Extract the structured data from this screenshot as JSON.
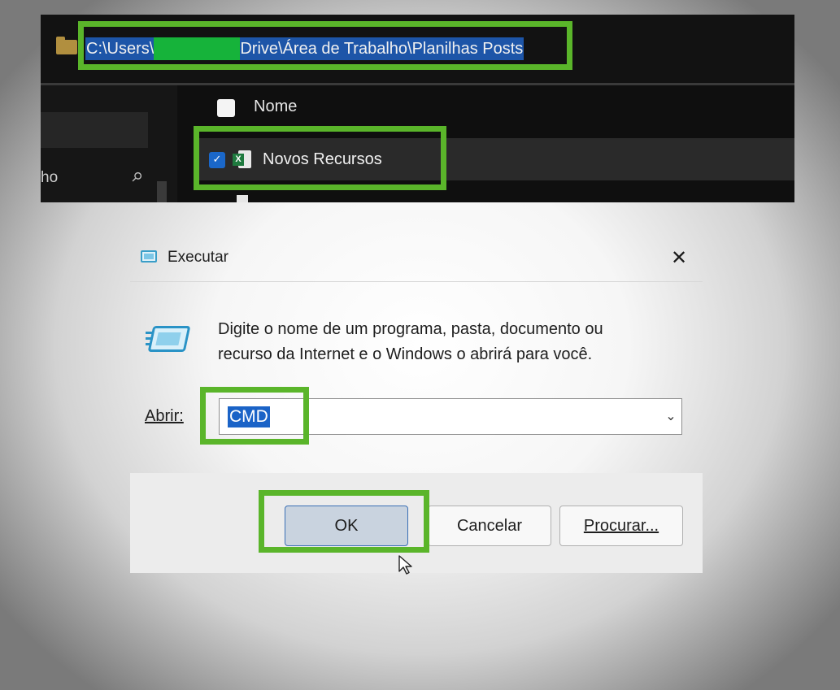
{
  "explorer": {
    "address": {
      "path_prefix": "C:\\Users\\",
      "path_suffix": "Drive\\Área de Trabalho\\Planilhas Posts"
    },
    "nav_pane": {
      "label": "ho"
    },
    "list": {
      "column_header": "Nome",
      "selected_file": "Novos Recursos"
    }
  },
  "run_dialog": {
    "title": "Executar",
    "description_line1": "Digite o nome de um programa, pasta, documento ou",
    "description_line2": "recurso da Internet e o Windows o abrirá para você.",
    "open_label": "Abrir:",
    "open_value": "CMD",
    "buttons": {
      "ok": "OK",
      "cancel": "Cancelar",
      "browse": "Procurar..."
    }
  },
  "colors": {
    "highlight_green": "#5ab52a",
    "selection_blue": "#1a63c7"
  },
  "icons": [
    "folder-icon",
    "pin-icon",
    "checkbox-icon",
    "excel-icon",
    "run-icon",
    "close-icon",
    "chevron-down-icon",
    "mouse-cursor-icon"
  ]
}
